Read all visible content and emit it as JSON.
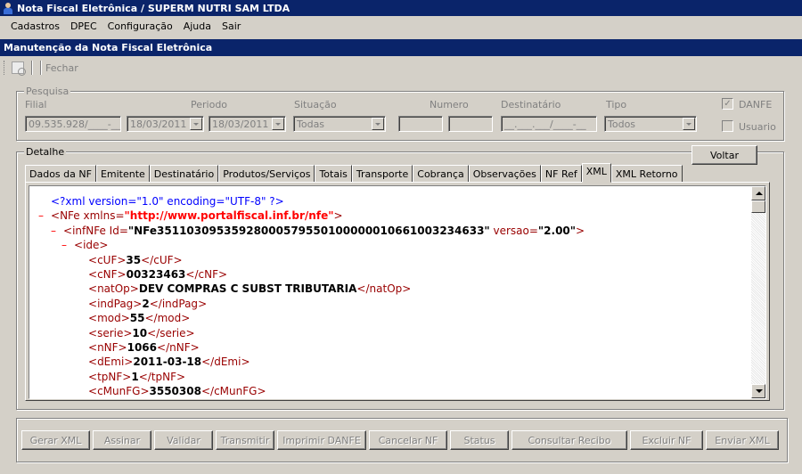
{
  "window": {
    "title": "Nota Fiscal Eletrônica / SUPERM NUTRI SAM LTDA"
  },
  "menu": [
    "Cadastros",
    "DPEC",
    "Configuração",
    "Ajuda",
    "Sair"
  ],
  "child_window": {
    "title": "Manutenção da Nota Fiscal Eletrônica"
  },
  "toolbar": {
    "close_label": "Fechar"
  },
  "search": {
    "group_label": "Pesquisa",
    "filial_label": "Filial",
    "filial_value": "09.535.928/____-__",
    "periodo_label": "Periodo",
    "date_from": "18/03/2011",
    "date_to": "18/03/2011",
    "situacao_label": "Situação",
    "situacao_value": "Todas",
    "numero_label": "Numero",
    "destinatario_label": "Destinatário",
    "destinatario_value": "__.___.___/____-__",
    "tipo_label": "Tipo",
    "tipo_value": "Todos",
    "danfe_label": "DANFE",
    "danfe_checked": true,
    "usuario_label": "Usuario",
    "usuario_checked": false
  },
  "detail": {
    "group_label": "Detalhe",
    "back_button": "Voltar",
    "tabs": [
      "Dados da NF",
      "Emitente",
      "Destinatário",
      "Produtos/Serviços",
      "Totais",
      "Transporte",
      "Cobrança",
      "Observações",
      "NF Ref",
      "XML",
      "XML Retorno"
    ],
    "active_tab": "XML"
  },
  "xml": {
    "pi": "<?xml version=\"1.0\" encoding=\"UTF-8\" ?>",
    "nfe_open": "NFe",
    "nfe_attr": "xmlns=",
    "nfe_ns": "\"http://www.portalfiscal.inf.br/nfe\"",
    "infnfe_open": "infNFe",
    "infnfe_id_attr": "Id=",
    "infnfe_id": "\"NFe35110309535928000579550100000010661003234633\"",
    "infnfe_ver_attr": "versao=",
    "infnfe_ver": "\"2.00\"",
    "ide": "ide",
    "fields": [
      {
        "tag": "cUF",
        "value": "35"
      },
      {
        "tag": "cNF",
        "value": "00323463"
      },
      {
        "tag": "natOp",
        "value": "DEV COMPRAS C SUBST TRIBUTARIA"
      },
      {
        "tag": "indPag",
        "value": "2"
      },
      {
        "tag": "mod",
        "value": "55"
      },
      {
        "tag": "serie",
        "value": "10"
      },
      {
        "tag": "nNF",
        "value": "1066"
      },
      {
        "tag": "dEmi",
        "value": "2011-03-18"
      },
      {
        "tag": "tpNF",
        "value": "1"
      },
      {
        "tag": "cMunFG",
        "value": "3550308"
      }
    ]
  },
  "actions": [
    "Gerar XML",
    "Assinar",
    "Validar",
    "Transmitir",
    "Imprimir DANFE",
    "Cancelar NF",
    "Status",
    "Consultar Recibo",
    "Excluir NF",
    "Enviar XML"
  ]
}
